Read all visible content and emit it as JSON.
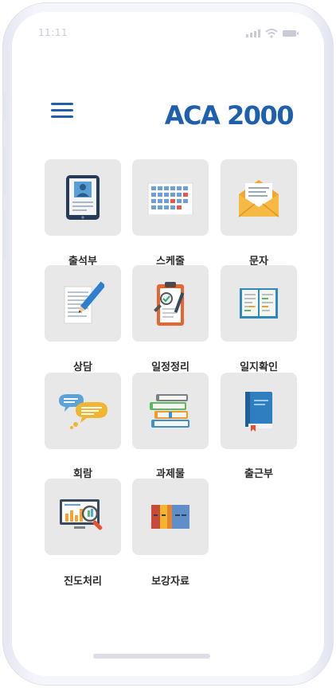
{
  "status_bar": {
    "time": "11:11"
  },
  "header": {
    "menu_icon": "hamburger-menu-icon",
    "logo": "ACA 2000"
  },
  "menu": [
    {
      "id": "attendance",
      "label": "출석부",
      "icon": "tablet-profile-icon"
    },
    {
      "id": "schedule",
      "label": "스케줄",
      "icon": "calendar-icon"
    },
    {
      "id": "message",
      "label": "문자",
      "icon": "envelope-icon"
    },
    {
      "id": "consult",
      "label": "상담",
      "icon": "document-pencil-icon"
    },
    {
      "id": "plan",
      "label": "일정정리",
      "icon": "clipboard-magnifier-icon"
    },
    {
      "id": "journal",
      "label": "일지확인",
      "icon": "open-book-icon"
    },
    {
      "id": "circular",
      "label": "회람",
      "icon": "speech-bubbles-icon"
    },
    {
      "id": "homework",
      "label": "과제물",
      "icon": "book-stack-icon"
    },
    {
      "id": "commute",
      "label": "출근부",
      "icon": "bookmark-book-icon"
    },
    {
      "id": "progress",
      "label": "진도처리",
      "icon": "monitor-chart-icon"
    },
    {
      "id": "supplement",
      "label": "보강자료",
      "icon": "binders-icon"
    }
  ],
  "colors": {
    "brand": "#1e5fae",
    "tile_bg": "#e8e8e8"
  }
}
